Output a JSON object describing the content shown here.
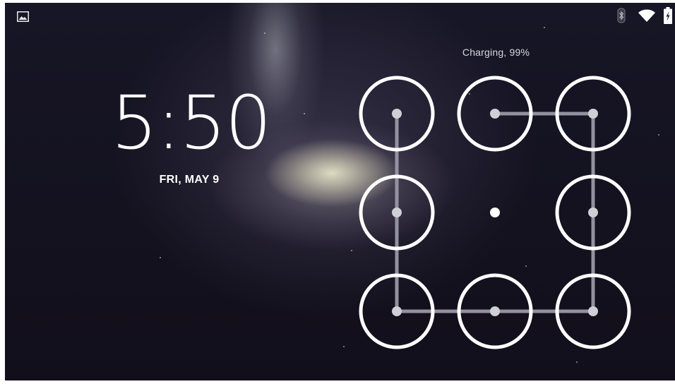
{
  "status_bar": {
    "notification_icon": "image-icon",
    "icons": [
      "bluetooth-icon",
      "wifi-icon",
      "battery-charging-icon"
    ]
  },
  "lock_screen": {
    "charging_text": "Charging, 99%",
    "time": "5:50",
    "date": "FRI, MAY 9"
  },
  "pattern": {
    "grid": "3x3",
    "dot_numbering": "1-3 top row, 4-6 middle row, 7-9 bottom row",
    "selected_dots": [
      1,
      2,
      3,
      4,
      6,
      7,
      8,
      9
    ],
    "unselected_dots": [
      5
    ],
    "drawn_sequence": [
      2,
      3,
      6,
      9,
      8,
      7,
      4,
      1
    ]
  },
  "colors": {
    "ring": "#ffffff",
    "path_line": "#9a98a6",
    "dot_selected": "#cfcfd6",
    "dot_unselected": "#ffffff",
    "text_primary": "#ffffff",
    "text_secondary": "#d8d8dc"
  }
}
